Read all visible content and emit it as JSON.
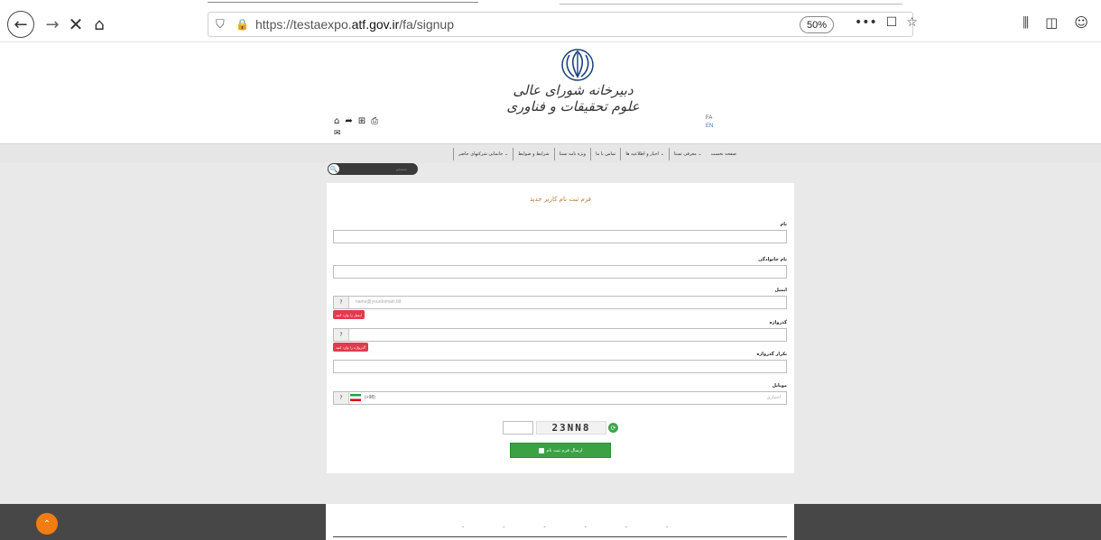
{
  "browser": {
    "url_prefix": "https://testaexpo.",
    "url_domain": "atf.gov.ir",
    "url_path": "/fa/signup",
    "zoom": "50%",
    "back_icon": "←",
    "forward_icon": "→",
    "stop_icon": "✕",
    "home_icon": "⌂",
    "shield_icon": "⛉",
    "lock_icon": "🔒",
    "more_icon": "•••",
    "pocket_icon": "☐",
    "star_icon": "☆",
    "library_icon": "⫼",
    "sidebar_icon": "◫",
    "account_icon": "☺"
  },
  "header": {
    "org_name": "دبیرخانه شورای عالی علوم تحقیقات و فناوری",
    "lang_fa": "FA",
    "lang_en": "EN",
    "tool_icons": [
      "⌂",
      "➦",
      "⊞",
      "⎙"
    ],
    "mail_icon": "✉"
  },
  "menu": {
    "items": [
      "صفحه نخست",
      "معرفی تستا ⌄",
      "اخبار و اطلاعیه ها ⌄",
      "تماس با ما",
      "ویژه نامه تستا",
      "شرایط و ضوابط",
      "جانمایی شرکتهای حاضر ⌄"
    ]
  },
  "search": {
    "placeholder": "جستجو",
    "icon": "🔍"
  },
  "form": {
    "title": "فرم ثبت نام کاربر جدید",
    "first_name_label": "نام",
    "last_name_label": "نام خانوادگی",
    "email_label": "ایمیل",
    "email_placeholder": "name@yourdomain.tld",
    "email_error": "ایمیل را وارد کنید",
    "password_label": "گذرواژه",
    "password_error": "گذرواژه را وارد کنید",
    "confirm_label": "تکرار گذرواژه",
    "mobile_label": "موبایل",
    "mobile_code": "(+98)",
    "mobile_optional": "اختیاری",
    "help_icon": "?",
    "captcha_text": "23NN8",
    "refresh_icon": "⟳",
    "submit_label": "ارسال فرم ثبت نام"
  },
  "footer": {
    "arrows": [
      "⌄",
      "⌄",
      "⌄",
      "⌄",
      "⌄",
      "⌄"
    ],
    "scroll_top_icon": "⌃"
  }
}
